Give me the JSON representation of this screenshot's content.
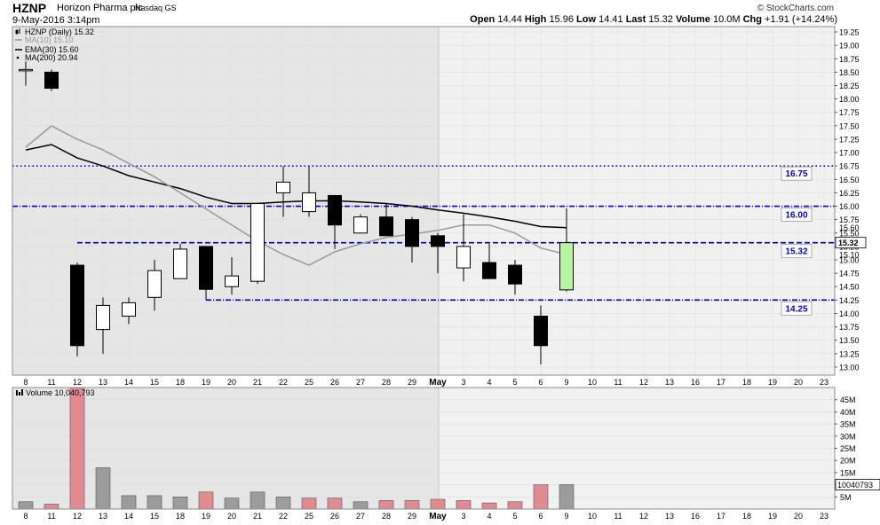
{
  "header": {
    "symbol": "HZNP",
    "company": "Horizon Pharma plc",
    "exchange": "Nasdaq GS",
    "date": "9-May-2016 3:14pm",
    "brand": "© StockCharts.com",
    "open_label": "Open",
    "open": "14.44",
    "high_label": "High",
    "high": "15.96",
    "low_label": "Low",
    "low": "14.41",
    "last_label": "Last",
    "last": "15.32",
    "volume_label": "Volume",
    "volume": "10.0M",
    "chg_label": "Chg",
    "chg": "+1.91 (+14.24%)"
  },
  "legend": [
    {
      "text": "HZNP (Daily) 15.32",
      "color": "#000000"
    },
    {
      "text": "MA(10) 15.10",
      "color": "#999999"
    },
    {
      "text": "EMA(30) 15.60",
      "color": "#000000"
    },
    {
      "text": "MA(200) 20.94",
      "color": "#000000"
    }
  ],
  "volume_legend": "Volume 10,040,793",
  "colors": {
    "up_volume": "#9c9c9c",
    "down_volume": "#e08a92",
    "trendline": "#0000cc",
    "highlight": "#b8f5a0"
  },
  "chart_data": [
    {
      "type": "candlestick",
      "x_labels": [
        "8",
        "11",
        "12",
        "13",
        "14",
        "15",
        "18",
        "19",
        "20",
        "21",
        "22",
        "25",
        "26",
        "27",
        "28",
        "29",
        "May",
        "3",
        "4",
        "5",
        "6",
        "9",
        "10",
        "11",
        "12",
        "13",
        "16",
        "17",
        "18",
        "19",
        "20",
        "23"
      ],
      "ylim": [
        12.85,
        19.35
      ],
      "y_ticks": [
        "13.00",
        "13.25",
        "13.50",
        "13.75",
        "14.00",
        "14.25",
        "14.50",
        "14.75",
        "15.00",
        "15.25",
        "15.50",
        "15.75",
        "16.00",
        "16.25",
        "16.50",
        "16.75",
        "17.00",
        "17.25",
        "17.50",
        "17.75",
        "18.00",
        "18.25",
        "18.50",
        "18.75",
        "19.00",
        "19.25"
      ],
      "candles": [
        {
          "i": 0,
          "o": 18.55,
          "h": 18.7,
          "l": 18.25,
          "c": 18.55
        },
        {
          "i": 1,
          "o": 18.5,
          "h": 18.55,
          "l": 18.15,
          "c": 18.2
        },
        {
          "i": 2,
          "o": 14.9,
          "h": 14.95,
          "l": 13.2,
          "c": 13.4
        },
        {
          "i": 3,
          "o": 13.7,
          "h": 14.3,
          "l": 13.25,
          "c": 14.15
        },
        {
          "i": 4,
          "o": 13.95,
          "h": 14.3,
          "l": 13.8,
          "c": 14.2
        },
        {
          "i": 5,
          "o": 14.3,
          "h": 15.0,
          "l": 14.05,
          "c": 14.8
        },
        {
          "i": 6,
          "o": 14.65,
          "h": 15.3,
          "l": 14.65,
          "c": 15.2
        },
        {
          "i": 7,
          "o": 15.25,
          "h": 15.25,
          "l": 14.25,
          "c": 14.45
        },
        {
          "i": 8,
          "o": 14.5,
          "h": 15.05,
          "l": 14.35,
          "c": 14.7
        },
        {
          "i": 9,
          "o": 14.6,
          "h": 16.05,
          "l": 14.55,
          "c": 16.05
        },
        {
          "i": 10,
          "o": 16.25,
          "h": 16.75,
          "l": 15.8,
          "c": 16.45
        },
        {
          "i": 11,
          "o": 15.9,
          "h": 16.75,
          "l": 15.8,
          "c": 16.25
        },
        {
          "i": 12,
          "o": 16.2,
          "h": 16.2,
          "l": 15.2,
          "c": 15.65
        },
        {
          "i": 13,
          "o": 15.5,
          "h": 15.85,
          "l": 15.5,
          "c": 15.8
        },
        {
          "i": 14,
          "o": 15.8,
          "h": 16.05,
          "l": 15.45,
          "c": 15.45
        },
        {
          "i": 15,
          "o": 15.75,
          "h": 15.8,
          "l": 14.95,
          "c": 15.25
        },
        {
          "i": 16,
          "o": 15.45,
          "h": 15.5,
          "l": 14.75,
          "c": 15.25
        },
        {
          "i": 17,
          "o": 14.85,
          "h": 15.85,
          "l": 14.6,
          "c": 15.25
        },
        {
          "i": 18,
          "o": 14.95,
          "h": 15.3,
          "l": 14.7,
          "c": 14.65
        },
        {
          "i": 19,
          "o": 14.9,
          "h": 15.0,
          "l": 14.35,
          "c": 14.55
        },
        {
          "i": 20,
          "o": 13.95,
          "h": 14.15,
          "l": 13.05,
          "c": 13.4
        },
        {
          "i": 21,
          "o": 14.44,
          "h": 15.96,
          "l": 14.41,
          "c": 15.32,
          "highlight": true
        }
      ],
      "series": [
        {
          "name": "EMA(30)",
          "color": "#000000",
          "points": [
            [
              0,
              17.05
            ],
            [
              1,
              17.15
            ],
            [
              2,
              16.9
            ],
            [
              3,
              16.75
            ],
            [
              4,
              16.57
            ],
            [
              5,
              16.45
            ],
            [
              6,
              16.33
            ],
            [
              7,
              16.17
            ],
            [
              8,
              16.05
            ],
            [
              9,
              16.05
            ],
            [
              10,
              16.08
            ],
            [
              11,
              16.1
            ],
            [
              12,
              16.1
            ],
            [
              13,
              16.08
            ],
            [
              14,
              16.05
            ],
            [
              15,
              16.0
            ],
            [
              16,
              15.93
            ],
            [
              17,
              15.87
            ],
            [
              18,
              15.8
            ],
            [
              19,
              15.72
            ],
            [
              20,
              15.62
            ],
            [
              21,
              15.6
            ]
          ]
        },
        {
          "name": "MA(10)",
          "color": "#999999",
          "points": [
            [
              0,
              17.1
            ],
            [
              1,
              17.5
            ],
            [
              2,
              17.25
            ],
            [
              3,
              17.05
            ],
            [
              4,
              16.8
            ],
            [
              5,
              16.55
            ],
            [
              6,
              16.25
            ],
            [
              7,
              15.95
            ],
            [
              8,
              15.65
            ],
            [
              9,
              15.35
            ],
            [
              10,
              15.1
            ],
            [
              11,
              14.9
            ],
            [
              12,
              15.15
            ],
            [
              13,
              15.3
            ],
            [
              14,
              15.42
            ],
            [
              15,
              15.48
            ],
            [
              16,
              15.55
            ],
            [
              17,
              15.65
            ],
            [
              18,
              15.65
            ],
            [
              19,
              15.5
            ],
            [
              20,
              15.22
            ],
            [
              21,
              15.1
            ]
          ]
        }
      ],
      "trendlines": [
        {
          "value": 16.75,
          "label": "16.75",
          "style": "dotted",
          "from": -0.7
        },
        {
          "value": 16.0,
          "label": "16.00",
          "style": "dashdot",
          "from": -0.7
        },
        {
          "value": 15.32,
          "label": "15.32",
          "style": "dashed",
          "from": 2
        },
        {
          "value": 14.25,
          "label": "14.25",
          "style": "dashdot",
          "from": 7
        }
      ],
      "last_price_tag": "15.32",
      "price_tags": [
        "15.60",
        "15.10"
      ]
    },
    {
      "type": "bar",
      "title": "Volume",
      "ylim": [
        0,
        50
      ],
      "y_ticks": [
        "5M",
        "10M",
        "15M",
        "20M",
        "25M",
        "30M",
        "35M",
        "40M",
        "45M"
      ],
      "last_tag": "10040793",
      "values": [
        3.0,
        2.0,
        50,
        17,
        5.5,
        5.5,
        5.0,
        7.0,
        4.5,
        7.0,
        5.0,
        4.5,
        4.5,
        3.0,
        3.5,
        3.5,
        4.0,
        3.5,
        2.5,
        3.0,
        10.0,
        10.04
      ],
      "direction": [
        "up",
        "down",
        "down",
        "up",
        "up",
        "up",
        "up",
        "down",
        "up",
        "up",
        "up",
        "down",
        "down",
        "up",
        "down",
        "down",
        "down",
        "down",
        "down",
        "down",
        "down",
        "up"
      ]
    }
  ]
}
